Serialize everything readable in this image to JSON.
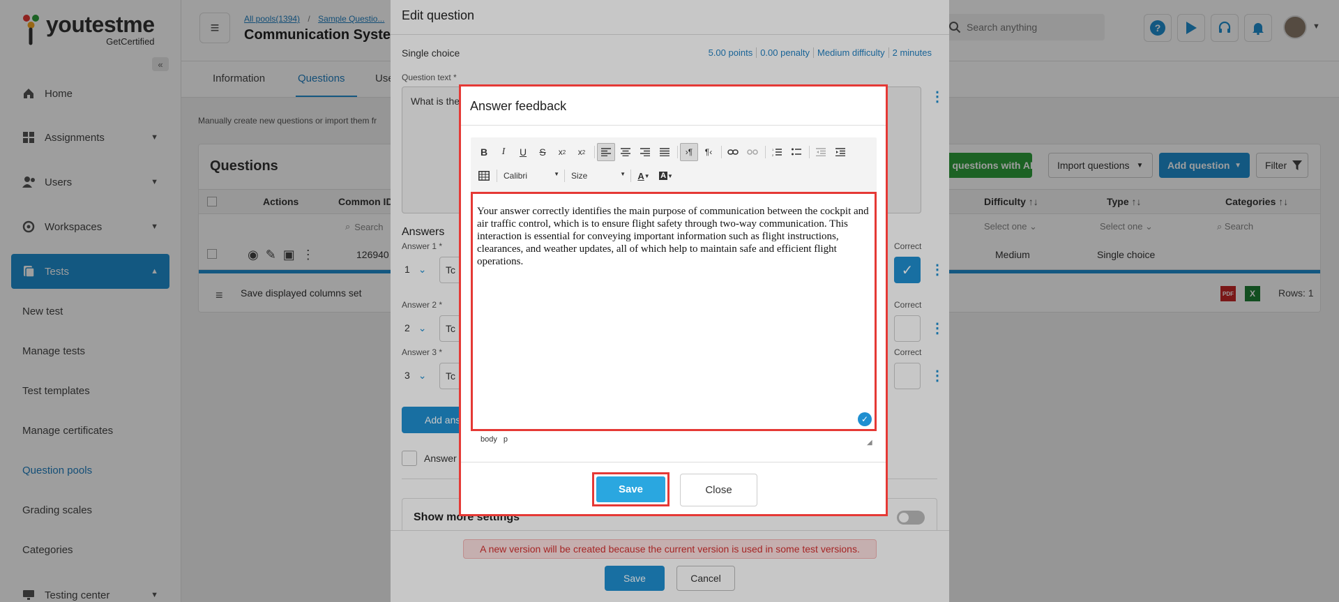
{
  "app": {
    "brand_name": "youtestme",
    "brand_sub": "GetCertified",
    "colors": {
      "primary": "#1f8fd0",
      "green": "#2e9e3a",
      "red": "#e53935"
    }
  },
  "sidebar": {
    "items": [
      {
        "label": "Home",
        "icon": "home-icon"
      },
      {
        "label": "Assignments",
        "icon": "assignments-icon"
      },
      {
        "label": "Users",
        "icon": "users-icon"
      },
      {
        "label": "Workspaces",
        "icon": "workspaces-icon"
      },
      {
        "label": "Tests",
        "icon": "tests-icon"
      }
    ],
    "sub_items": [
      "New test",
      "Manage tests",
      "Test templates",
      "Manage certificates",
      "Question pools",
      "Grading scales",
      "Categories"
    ],
    "bottom_item": "Testing center"
  },
  "header": {
    "breadcrumb": [
      "All pools(1394)",
      "Sample Questio..."
    ],
    "title": "Communication System",
    "search_placeholder": "Search anything"
  },
  "tabs": [
    "Information",
    "Questions",
    "Use"
  ],
  "page": {
    "hint": "Manually create new questions or import them fr",
    "panel_title": "Questions",
    "ai_button": "te questions with AI",
    "import_button": "Import questions",
    "add_button": "Add question",
    "filter_button": "Filter",
    "columns": {
      "actions": "Actions",
      "common_id": "Common ID",
      "difficulty": "Difficulty",
      "type": "Type",
      "categories": "Categories"
    },
    "filter_search": "Search",
    "filter_select": "Select one",
    "row": {
      "id": "126940",
      "difficulty": "Medium",
      "type": "Single choice"
    },
    "save_columns": "Save displayed columns set",
    "rows_label": "Rows: 1"
  },
  "edit_question": {
    "title": "Edit question",
    "question_type": "Single choice",
    "meta": [
      "5.00 points",
      "0.00 penalty",
      "Medium difficulty",
      "2 minutes"
    ],
    "question_label": "Question text *",
    "question_text": "What is the",
    "answers_heading": "Answers",
    "answers": [
      {
        "label": "Answer 1 *",
        "num": "1",
        "correct": true
      },
      {
        "label": "Answer 2 *",
        "num": "2",
        "correct": false
      },
      {
        "label": "Answer 3 *",
        "num": "3",
        "correct": false
      }
    ],
    "answer_value": "Tc",
    "correct_label": "Correct",
    "add_answer": "Add ans",
    "answer_checkbox": "Answer",
    "more_settings": "Show more settings",
    "warning": "A new version will be created because the current version is used in some test versions.",
    "save": "Save",
    "cancel": "Cancel"
  },
  "feedback_dialog": {
    "title": "Answer feedback",
    "font": "Calibri",
    "size": "Size",
    "body_text": "Your answer correctly identifies the main purpose of communication between the cockpit and air traffic control, which is to ensure flight safety through two-way communication. This interaction is essential for conveying important information such as flight instructions, clearances, and weather updates, all of which help to maintain safe and efficient flight operations.",
    "path": [
      "body",
      "p"
    ],
    "save": "Save",
    "close": "Close"
  }
}
